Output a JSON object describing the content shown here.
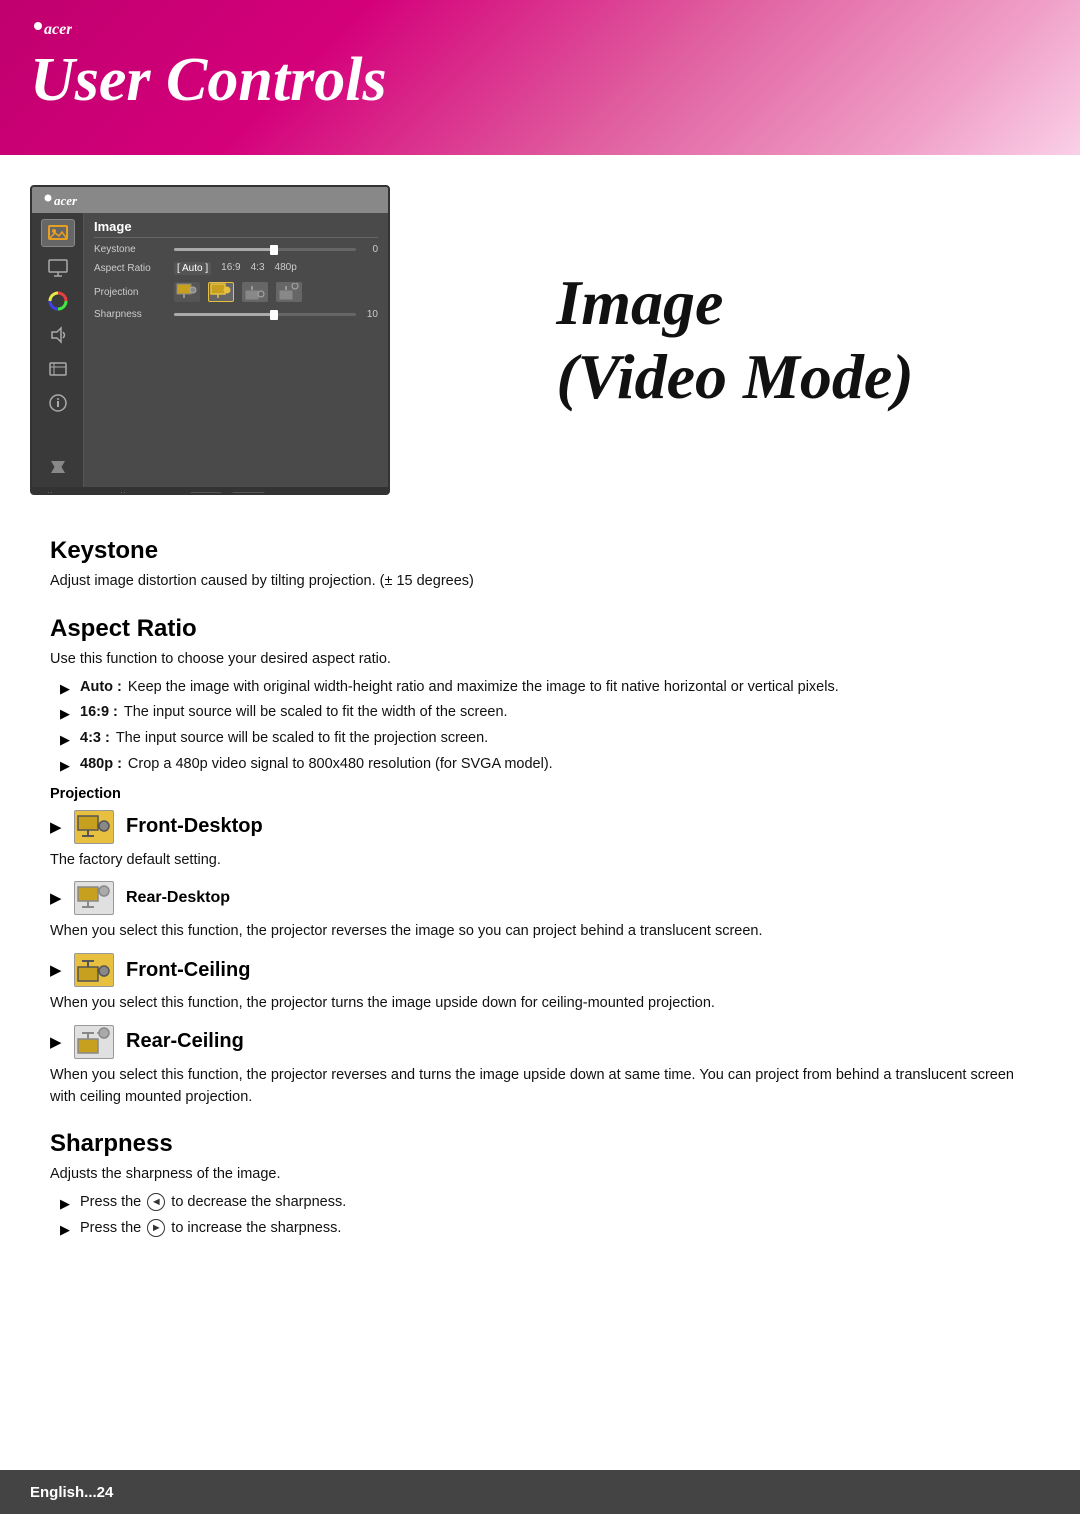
{
  "header": {
    "brand": "acer",
    "title": "User Controls"
  },
  "osd": {
    "brand": "acer",
    "menu_title": "Image",
    "rows": [
      {
        "label": "Keystone",
        "type": "slider",
        "fill_pct": 55,
        "value": "0"
      },
      {
        "label": "Aspect Ratio",
        "type": "options",
        "options": [
          "[ Auto ]",
          "16:9",
          "4:3",
          "480p"
        ]
      },
      {
        "label": "Projection",
        "type": "icons"
      },
      {
        "label": "Sharpness",
        "type": "slider",
        "fill_pct": 55,
        "value": "10"
      }
    ],
    "footer_items": [
      "Select",
      "Adjust",
      "BACK",
      "MENU",
      "Main menu"
    ]
  },
  "image_title": {
    "line1": "Image",
    "line2": "(Video Mode)"
  },
  "sections": {
    "keystone": {
      "heading": "Keystone",
      "text": "Adjust image distortion caused by tilting projection. (± 15 degrees)"
    },
    "aspect_ratio": {
      "heading": "Aspect Ratio",
      "intro": "Use this function to choose your desired aspect ratio.",
      "items": [
        {
          "label": "Auto :",
          "text": "Keep the image with original width-height ratio and maximize the image to fit native horizontal or vertical pixels."
        },
        {
          "label": "16:9 :",
          "text": "The input source will be scaled to fit the width of the screen."
        },
        {
          "label": "4:3 :",
          "text": "The input source will be scaled to fit the projection screen."
        },
        {
          "label": "480p :",
          "text": "Crop a 480p video signal to 800x480 resolution (for SVGA model)."
        }
      ]
    },
    "projection_label": "Projection",
    "front_desktop": {
      "title": "Front-Desktop",
      "text": "The factory default setting."
    },
    "rear_desktop": {
      "title": "Rear-Desktop",
      "text": "When you select this function, the projector reverses the image so you can project behind a translucent screen."
    },
    "front_ceiling": {
      "title": "Front-Ceiling",
      "text": "When you select this function, the projector turns the image upside down for ceiling-mounted projection."
    },
    "rear_ceiling": {
      "title": "Rear-Ceiling",
      "text": "When you select this function, the projector reverses and turns the image upside down at same time. You can project from behind a translucent screen with ceiling mounted projection."
    },
    "sharpness": {
      "heading": "Sharpness",
      "intro": "Adjusts the sharpness of the image.",
      "items": [
        {
          "text": "Press the",
          "btn": "◄",
          "suffix": " to decrease the sharpness."
        },
        {
          "text": "Press the",
          "btn": "►",
          "suffix": " to increase the sharpness."
        }
      ]
    }
  },
  "footer": {
    "text": "English...24"
  }
}
